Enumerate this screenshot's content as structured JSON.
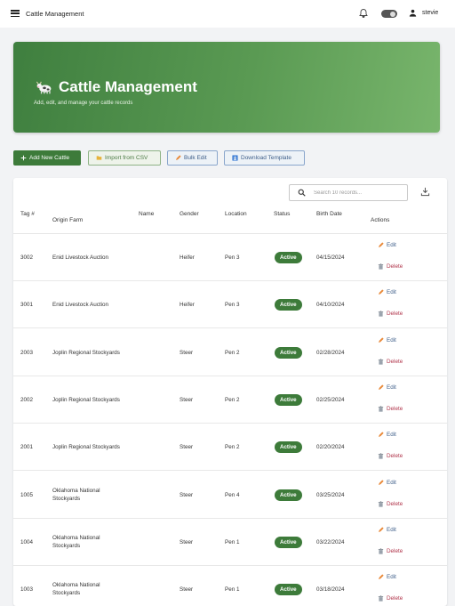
{
  "topbar": {
    "app_title": "Cattle Management",
    "username": "stevie"
  },
  "hero": {
    "title": "Cattle Management",
    "subtitle": "Add, edit, and manage your cattle records"
  },
  "actions": {
    "add_label": "Add New Cattle",
    "import_label": "Import from CSV",
    "bulk_label": "Bulk Edit",
    "template_label": "Download Template"
  },
  "search": {
    "placeholder": "Search 10 records..."
  },
  "table": {
    "columns": [
      "Tag #",
      "Origin Farm",
      "Name",
      "Gender",
      "Location",
      "Status",
      "Birth Date",
      "Actions"
    ],
    "edit_label": "Edit",
    "delete_label": "Delete",
    "rows": [
      {
        "tag": "3002",
        "farm1": "Enid Livestock Auction",
        "farm2": "",
        "name": "",
        "gender": "Heifer",
        "location": "Pen 3",
        "status": "Active",
        "birth": "04/15/2024"
      },
      {
        "tag": "3001",
        "farm1": "Enid Livestock Auction",
        "farm2": "",
        "name": "",
        "gender": "Heifer",
        "location": "Pen 3",
        "status": "Active",
        "birth": "04/10/2024"
      },
      {
        "tag": "2003",
        "farm1": "Joplin Regional Stockyards",
        "farm2": "",
        "name": "",
        "gender": "Steer",
        "location": "Pen 2",
        "status": "Active",
        "birth": "02/28/2024"
      },
      {
        "tag": "2002",
        "farm1": "Joplin Regional Stockyards",
        "farm2": "",
        "name": "",
        "gender": "Steer",
        "location": "Pen 2",
        "status": "Active",
        "birth": "02/25/2024"
      },
      {
        "tag": "2001",
        "farm1": "Joplin Regional Stockyards",
        "farm2": "",
        "name": "",
        "gender": "Steer",
        "location": "Pen 2",
        "status": "Active",
        "birth": "02/20/2024"
      },
      {
        "tag": "1005",
        "farm1": "Oklahoma National",
        "farm2": "Stockyards",
        "name": "",
        "gender": "Steer",
        "location": "Pen 4",
        "status": "Active",
        "birth": "03/25/2024"
      },
      {
        "tag": "1004",
        "farm1": "Oklahoma National",
        "farm2": "Stockyards",
        "name": "",
        "gender": "Steer",
        "location": "Pen 1",
        "status": "Active",
        "birth": "03/22/2024"
      },
      {
        "tag": "1003",
        "farm1": "Oklahoma National",
        "farm2": "Stockyards",
        "name": "",
        "gender": "Steer",
        "location": "Pen 1",
        "status": "Active",
        "birth": "03/18/2024"
      }
    ]
  },
  "colors": {
    "primary_green": "#3d7b3a",
    "hero_start": "#3f7f3f",
    "hero_end": "#78b56c",
    "edit_blue": "#3f5f8a",
    "delete_red": "#b0344a"
  },
  "icons": {
    "menu": "menu-icon",
    "notifications": "bell-icon",
    "theme": "toggle-switch",
    "user": "user-icon",
    "hero": "cow-icon",
    "add": "plus-icon",
    "import": "folder-icon",
    "bulk": "pencil-icon",
    "template": "download-box-icon",
    "search": "search-icon",
    "export": "download-icon",
    "edit": "pencil-icon",
    "delete": "trash-icon"
  }
}
